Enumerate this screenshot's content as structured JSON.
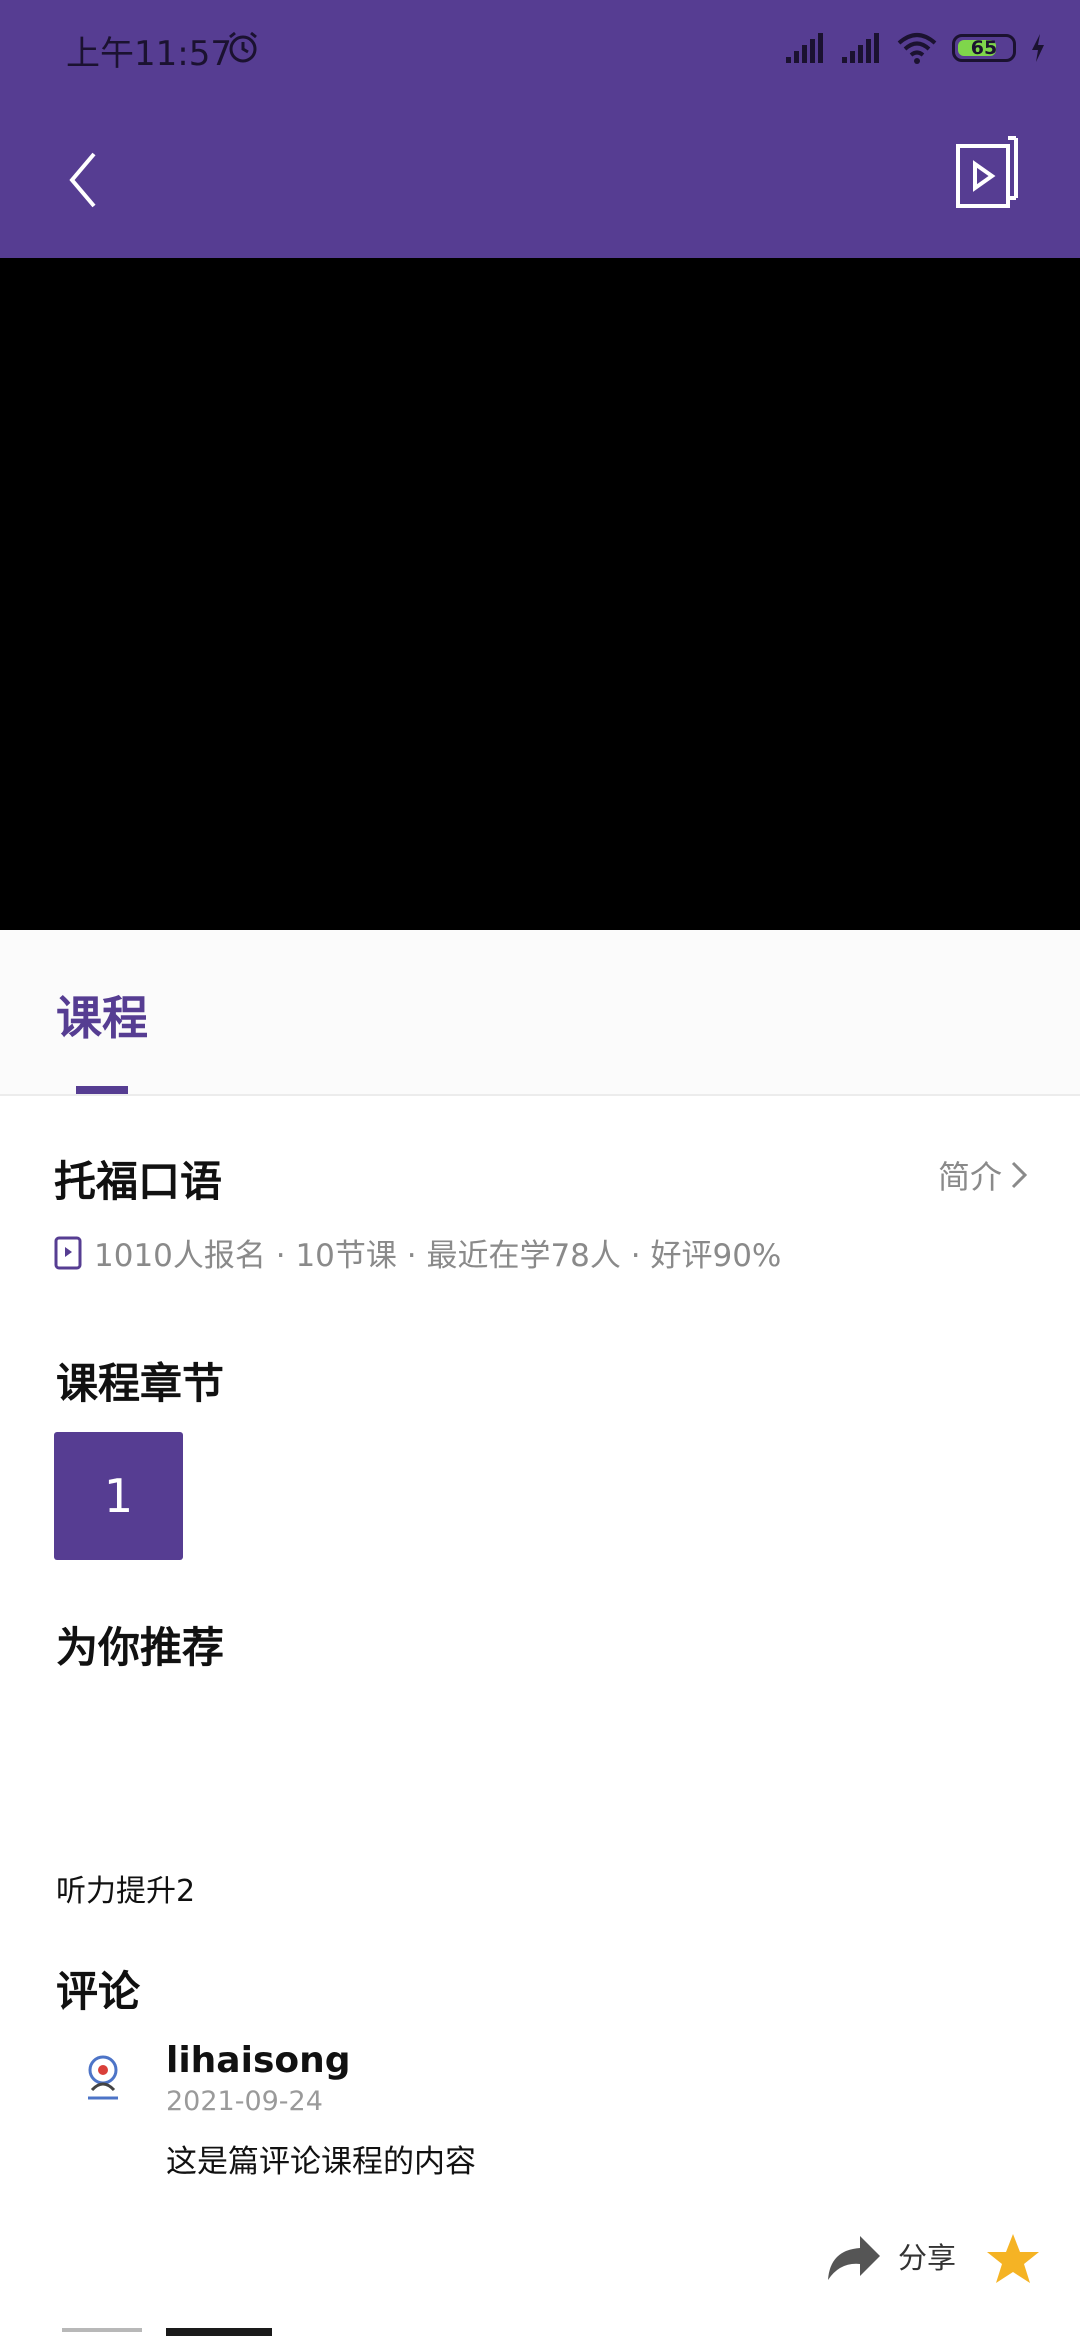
{
  "status_bar": {
    "time": "上午11:57",
    "battery_level": "65",
    "background_color": "#563d92"
  },
  "app_bar": {
    "back_icon": "chevron-left-icon",
    "video_icon": "video-play-icon"
  },
  "tabs": [
    {
      "label": "课程",
      "active": true
    }
  ],
  "course": {
    "title": "托福口语",
    "intro_label": "简介",
    "stats": "1010人报名 · 10节课 · 最近在学78人 · 好评90%"
  },
  "chapters": {
    "title": "课程章节",
    "items": [
      "1"
    ]
  },
  "recommend": {
    "title": "为你推荐",
    "items": [
      "听力提升2"
    ]
  },
  "comments": {
    "title": "评论",
    "items": [
      {
        "user": "lihaisong",
        "date": "2021-09-24",
        "text": "这是篇评论课程的内容"
      }
    ]
  },
  "actions": {
    "share_label": "分享",
    "favorite_color": "#f5b324"
  },
  "colors": {
    "accent": "#563d92",
    "muted_text": "#8a8a8a"
  }
}
